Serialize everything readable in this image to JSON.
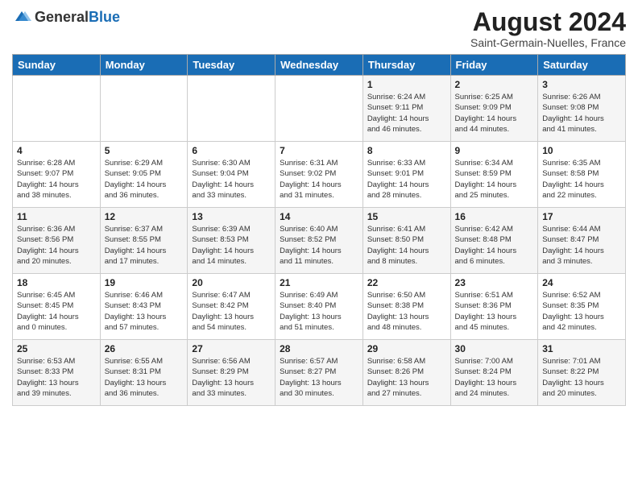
{
  "header": {
    "logo_general": "General",
    "logo_blue": "Blue",
    "month_year": "August 2024",
    "location": "Saint-Germain-Nuelles, France"
  },
  "weekdays": [
    "Sunday",
    "Monday",
    "Tuesday",
    "Wednesday",
    "Thursday",
    "Friday",
    "Saturday"
  ],
  "weeks": [
    [
      {
        "day": "",
        "info": ""
      },
      {
        "day": "",
        "info": ""
      },
      {
        "day": "",
        "info": ""
      },
      {
        "day": "",
        "info": ""
      },
      {
        "day": "1",
        "info": "Sunrise: 6:24 AM\nSunset: 9:11 PM\nDaylight: 14 hours\nand 46 minutes."
      },
      {
        "day": "2",
        "info": "Sunrise: 6:25 AM\nSunset: 9:09 PM\nDaylight: 14 hours\nand 44 minutes."
      },
      {
        "day": "3",
        "info": "Sunrise: 6:26 AM\nSunset: 9:08 PM\nDaylight: 14 hours\nand 41 minutes."
      }
    ],
    [
      {
        "day": "4",
        "info": "Sunrise: 6:28 AM\nSunset: 9:07 PM\nDaylight: 14 hours\nand 38 minutes."
      },
      {
        "day": "5",
        "info": "Sunrise: 6:29 AM\nSunset: 9:05 PM\nDaylight: 14 hours\nand 36 minutes."
      },
      {
        "day": "6",
        "info": "Sunrise: 6:30 AM\nSunset: 9:04 PM\nDaylight: 14 hours\nand 33 minutes."
      },
      {
        "day": "7",
        "info": "Sunrise: 6:31 AM\nSunset: 9:02 PM\nDaylight: 14 hours\nand 31 minutes."
      },
      {
        "day": "8",
        "info": "Sunrise: 6:33 AM\nSunset: 9:01 PM\nDaylight: 14 hours\nand 28 minutes."
      },
      {
        "day": "9",
        "info": "Sunrise: 6:34 AM\nSunset: 8:59 PM\nDaylight: 14 hours\nand 25 minutes."
      },
      {
        "day": "10",
        "info": "Sunrise: 6:35 AM\nSunset: 8:58 PM\nDaylight: 14 hours\nand 22 minutes."
      }
    ],
    [
      {
        "day": "11",
        "info": "Sunrise: 6:36 AM\nSunset: 8:56 PM\nDaylight: 14 hours\nand 20 minutes."
      },
      {
        "day": "12",
        "info": "Sunrise: 6:37 AM\nSunset: 8:55 PM\nDaylight: 14 hours\nand 17 minutes."
      },
      {
        "day": "13",
        "info": "Sunrise: 6:39 AM\nSunset: 8:53 PM\nDaylight: 14 hours\nand 14 minutes."
      },
      {
        "day": "14",
        "info": "Sunrise: 6:40 AM\nSunset: 8:52 PM\nDaylight: 14 hours\nand 11 minutes."
      },
      {
        "day": "15",
        "info": "Sunrise: 6:41 AM\nSunset: 8:50 PM\nDaylight: 14 hours\nand 8 minutes."
      },
      {
        "day": "16",
        "info": "Sunrise: 6:42 AM\nSunset: 8:48 PM\nDaylight: 14 hours\nand 6 minutes."
      },
      {
        "day": "17",
        "info": "Sunrise: 6:44 AM\nSunset: 8:47 PM\nDaylight: 14 hours\nand 3 minutes."
      }
    ],
    [
      {
        "day": "18",
        "info": "Sunrise: 6:45 AM\nSunset: 8:45 PM\nDaylight: 14 hours\nand 0 minutes."
      },
      {
        "day": "19",
        "info": "Sunrise: 6:46 AM\nSunset: 8:43 PM\nDaylight: 13 hours\nand 57 minutes."
      },
      {
        "day": "20",
        "info": "Sunrise: 6:47 AM\nSunset: 8:42 PM\nDaylight: 13 hours\nand 54 minutes."
      },
      {
        "day": "21",
        "info": "Sunrise: 6:49 AM\nSunset: 8:40 PM\nDaylight: 13 hours\nand 51 minutes."
      },
      {
        "day": "22",
        "info": "Sunrise: 6:50 AM\nSunset: 8:38 PM\nDaylight: 13 hours\nand 48 minutes."
      },
      {
        "day": "23",
        "info": "Sunrise: 6:51 AM\nSunset: 8:36 PM\nDaylight: 13 hours\nand 45 minutes."
      },
      {
        "day": "24",
        "info": "Sunrise: 6:52 AM\nSunset: 8:35 PM\nDaylight: 13 hours\nand 42 minutes."
      }
    ],
    [
      {
        "day": "25",
        "info": "Sunrise: 6:53 AM\nSunset: 8:33 PM\nDaylight: 13 hours\nand 39 minutes."
      },
      {
        "day": "26",
        "info": "Sunrise: 6:55 AM\nSunset: 8:31 PM\nDaylight: 13 hours\nand 36 minutes."
      },
      {
        "day": "27",
        "info": "Sunrise: 6:56 AM\nSunset: 8:29 PM\nDaylight: 13 hours\nand 33 minutes."
      },
      {
        "day": "28",
        "info": "Sunrise: 6:57 AM\nSunset: 8:27 PM\nDaylight: 13 hours\nand 30 minutes."
      },
      {
        "day": "29",
        "info": "Sunrise: 6:58 AM\nSunset: 8:26 PM\nDaylight: 13 hours\nand 27 minutes."
      },
      {
        "day": "30",
        "info": "Sunrise: 7:00 AM\nSunset: 8:24 PM\nDaylight: 13 hours\nand 24 minutes."
      },
      {
        "day": "31",
        "info": "Sunrise: 7:01 AM\nSunset: 8:22 PM\nDaylight: 13 hours\nand 20 minutes."
      }
    ]
  ]
}
